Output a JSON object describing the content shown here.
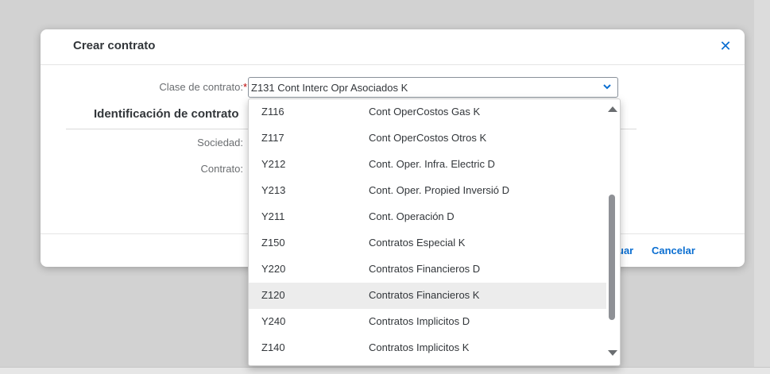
{
  "dialog": {
    "title": "Crear contrato",
    "close_icon": "close-icon",
    "clase_label": "Clase de contrato:",
    "required_mark": "*",
    "clase_value": "Z131 Cont Interc Opr Asociados K",
    "section_title": "Identificación de contrato",
    "sociedad_label": "Sociedad:",
    "contrato_label": "Contrato:",
    "continue_label": "uar",
    "cancel_label": "Cancelar",
    "accent_color": "#0a6ed1"
  },
  "dropdown": {
    "options": [
      {
        "code": "Z116",
        "desc": "Cont OperCostos Gas K"
      },
      {
        "code": "Z117",
        "desc": "Cont OperCostos Otros K"
      },
      {
        "code": "Y212",
        "desc": "Cont. Oper. Infra. Electric D"
      },
      {
        "code": "Y213",
        "desc": "Cont. Oper. Propied Inversió D"
      },
      {
        "code": "Y211",
        "desc": "Cont. Operación D"
      },
      {
        "code": "Z150",
        "desc": "Contratos Especial K"
      },
      {
        "code": "Y220",
        "desc": "Contratos Financieros D"
      },
      {
        "code": "Z120",
        "desc": "Contratos Financieros K"
      },
      {
        "code": "Y240",
        "desc": "Contratos Implicitos D"
      },
      {
        "code": "Z140",
        "desc": "Contratos Implicitos K"
      }
    ],
    "highlighted_index": 7,
    "scroll_icons": [
      "scroll-up-icon",
      "scroll-down-icon"
    ]
  }
}
